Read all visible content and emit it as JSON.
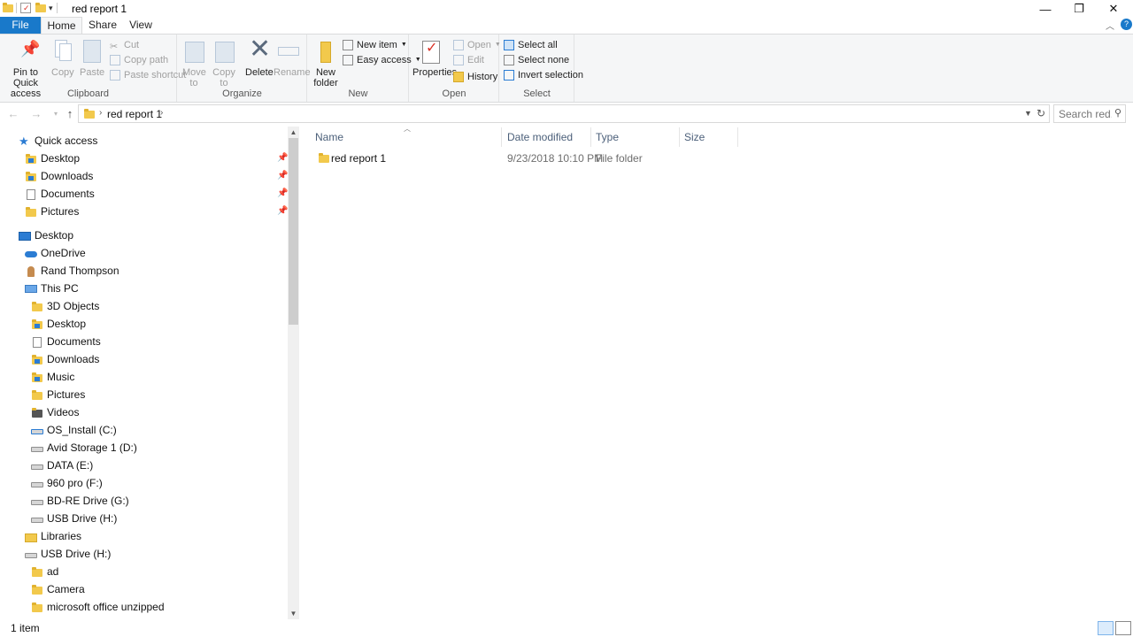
{
  "window": {
    "title": "red report 1",
    "qa_dropdown": "▾",
    "minimize": "—",
    "restore": "❐",
    "close": "✕"
  },
  "ribbon_tabs": [
    "File",
    "Home",
    "Share",
    "View"
  ],
  "ribbon": {
    "clipboard": {
      "label": "Clipboard",
      "pin": "Pin to Quick access",
      "copy": "Copy",
      "paste": "Paste",
      "cut": "Cut",
      "copy_path": "Copy path",
      "paste_shortcut": "Paste shortcut"
    },
    "organize": {
      "label": "Organize",
      "move_to": "Move to",
      "copy_to": "Copy to",
      "delete": "Delete",
      "rename": "Rename"
    },
    "new": {
      "label": "New",
      "new_folder": "New folder",
      "new_item": "New item",
      "easy_access": "Easy access"
    },
    "open": {
      "label": "Open",
      "properties": "Properties",
      "open": "Open",
      "edit": "Edit",
      "history": "History"
    },
    "select": {
      "label": "Select",
      "select_all": "Select all",
      "select_none": "Select none",
      "invert": "Invert selection"
    }
  },
  "address": {
    "crumb": "red report 1",
    "search_placeholder": "Search red..."
  },
  "nav_pane": {
    "quick_access": "Quick access",
    "quick_items": [
      "Desktop",
      "Downloads",
      "Documents",
      "Pictures"
    ],
    "desktop": "Desktop",
    "onedrive": "OneDrive",
    "user": "Rand Thompson",
    "this_pc": "This PC",
    "pc_items": [
      "3D Objects",
      "Desktop",
      "Documents",
      "Downloads",
      "Music",
      "Pictures",
      "Videos",
      "OS_Install (C:)",
      "Avid Storage 1 (D:)",
      "DATA (E:)",
      "960 pro (F:)",
      "BD-RE Drive (G:)",
      "USB Drive (H:)"
    ],
    "libraries": "Libraries",
    "usb_drive": "USB Drive (H:)",
    "usb_items": [
      "ad",
      "Camera",
      "microsoft office unzipped"
    ]
  },
  "file_list": {
    "columns": [
      "Name",
      "Date modified",
      "Type",
      "Size"
    ],
    "rows": [
      {
        "name": "red report 1",
        "date": "9/23/2018 10:10 PM",
        "type": "File folder",
        "size": ""
      }
    ]
  },
  "status": {
    "count": "1 item"
  },
  "colors": {
    "accent": "#1979ca",
    "folder": "#f2c94c"
  }
}
